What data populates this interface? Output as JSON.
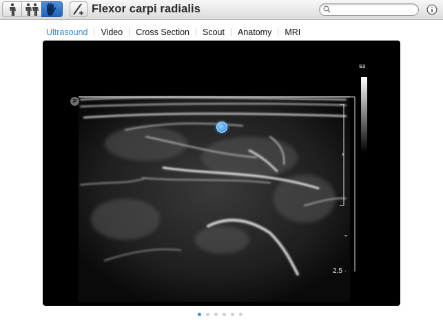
{
  "toolbar": {
    "view_buttons": [
      {
        "icon": "single-body-icon",
        "selected": false
      },
      {
        "icon": "front-back-body-icon",
        "selected": false
      },
      {
        "icon": "hand-icon",
        "selected": true
      }
    ],
    "draw_icon": "pencil-plus-icon",
    "title": "Flexor carpi radialis",
    "search": {
      "value": "",
      "placeholder": ""
    },
    "info_icon": "info-icon"
  },
  "tabs": [
    {
      "label": "Ultrasound",
      "active": true
    },
    {
      "label": "Video",
      "active": false
    },
    {
      "label": "Cross Section",
      "active": false
    },
    {
      "label": "Scout",
      "active": false
    },
    {
      "label": "Anatomy",
      "active": false
    },
    {
      "label": "MRI",
      "active": false
    }
  ],
  "image": {
    "probe_label": "S3",
    "marker_label": "P",
    "depth_label": "2.5"
  },
  "pager": {
    "count": 6,
    "current": 1
  },
  "colors": {
    "accent": "#2f8bd3",
    "hotspot": "#3b8ee6"
  }
}
